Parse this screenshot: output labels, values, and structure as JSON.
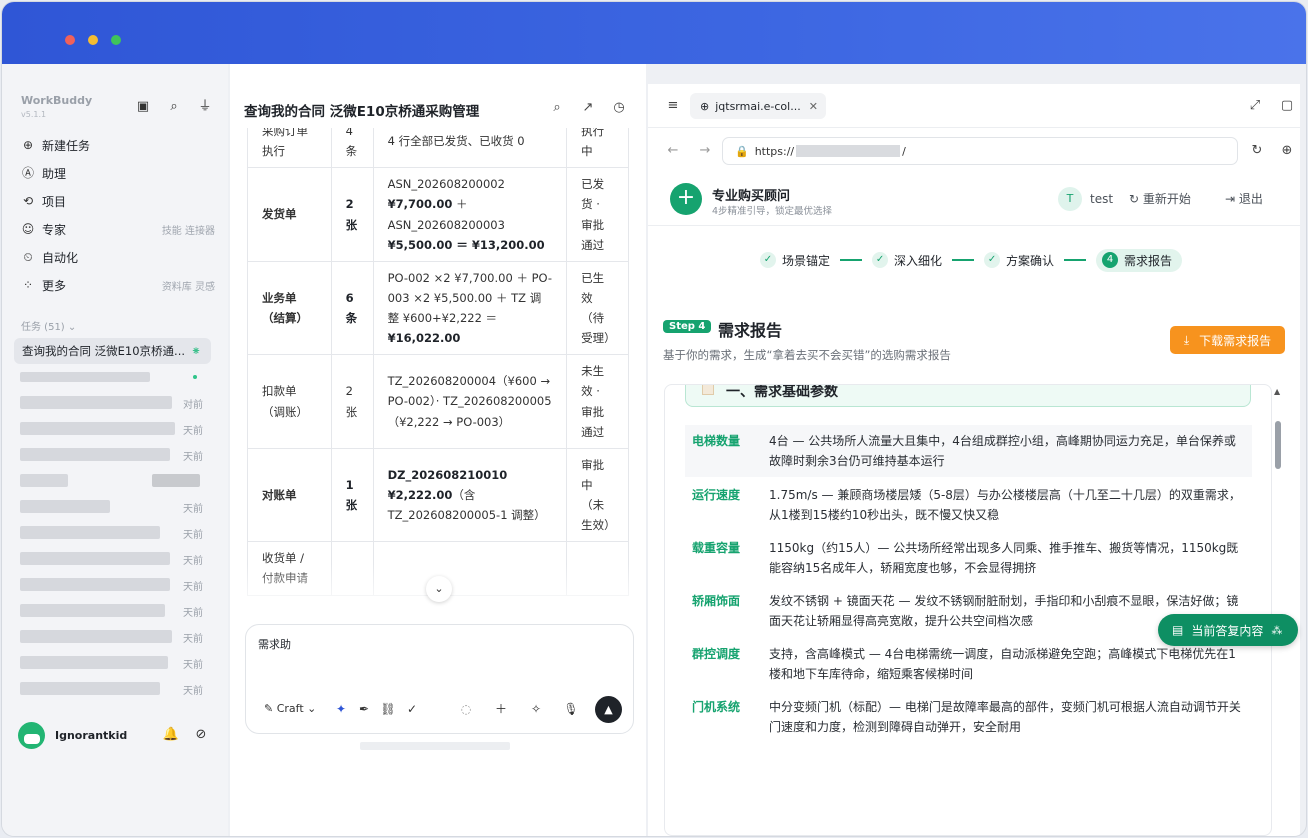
{
  "sidebar": {
    "brand": "WorkBuddy",
    "version": "v5.1.1",
    "nav": [
      {
        "icon": "plus-circle-icon",
        "label": "新建任务",
        "hint": ""
      },
      {
        "icon": "assistant-icon",
        "label": "助理",
        "hint": ""
      },
      {
        "icon": "project-icon",
        "label": "项目",
        "hint": ""
      },
      {
        "icon": "expert-icon",
        "label": "专家",
        "hint": "技能 连接器"
      },
      {
        "icon": "automation-icon",
        "label": "自动化",
        "hint": ""
      },
      {
        "icon": "more-icon",
        "label": "更多",
        "hint": "资料库 灵感"
      }
    ],
    "tasks_header": "任务 (51) ⌄",
    "active_task": "查询我的合同 泛微E10京桥通...",
    "task_times": [
      "",
      "对前",
      "天前",
      "天前",
      "",
      "天前",
      "天前",
      "天前",
      "天前",
      "天前",
      "天前",
      "天前",
      "天前"
    ],
    "username": "Ignorantkid"
  },
  "chat": {
    "title": "查询我的合同 泛微E10京桥通采购管理",
    "table": [
      {
        "c1": "采购订单执行",
        "c2": "4条",
        "c3": [
          {
            "t": "4 行全部已发货、已收货 0",
            "b": false
          }
        ],
        "c4": "执行中",
        "bold": false
      },
      {
        "c1": "发货单",
        "c2": "2张",
        "c3": [
          {
            "t": "ASN_202608200002 ",
            "b": false
          },
          {
            "t": "¥7,700.00",
            "b": true
          },
          {
            "t": " ＋ ASN_202608200003 ",
            "b": false
          },
          {
            "t": "¥5,500.00 ＝ ¥13,200.00",
            "b": true
          }
        ],
        "c4": "已发货 · 审批通过",
        "bold": true
      },
      {
        "c1": "业务单（结算）",
        "c2": "6条",
        "c3": [
          {
            "t": "PO-002 ×2 ¥7,700.00 ＋ PO-003 ×2 ¥5,500.00 ＋ TZ 调整 ¥600+¥2,222 ＝ ",
            "b": false
          },
          {
            "t": "¥16,022.00",
            "b": true
          }
        ],
        "c4": "已生效（待受理）",
        "bold": true
      },
      {
        "c1": "扣款单（调账）",
        "c2": "2张",
        "c3": [
          {
            "t": "TZ_202608200004（¥600 → PO-002）· TZ_202608200005（¥2,222 → PO-003）",
            "b": false
          }
        ],
        "c4": "未生效 · 审批通过",
        "bold": false
      },
      {
        "c1": "对账单",
        "c2": "1张",
        "c3": [
          {
            "t": "DZ_202608210010 ¥2,222.00",
            "b": true
          },
          {
            "t": "（含 TZ_202608200005-1 调整）",
            "b": false
          }
        ],
        "c4": "审批中（未生效）",
        "bold": true
      },
      {
        "c1": "收货单 / 付款申请",
        "c2": "",
        "c3": [
          {
            "t": "",
            "b": false
          }
        ],
        "c4": "",
        "bold": false
      }
    ],
    "composer_text": "需求助",
    "mode_label": "Craft"
  },
  "browser": {
    "tab_title": "jqtsrmai.e-col...",
    "url_prefix": "https://",
    "url_suffix": "/",
    "app_title": "专业购买顾问",
    "app_subtitle": "4步精准引导，锁定最优选择",
    "user_initial": "T",
    "user_name": "test",
    "restart_label": "重新开始",
    "logout_label": "退出",
    "steps": [
      "场景锚定",
      "深入细化",
      "方案确认",
      "需求报告"
    ],
    "current_step_number": "4",
    "step_badge": "Step 4",
    "report_title": "需求报告",
    "report_subtitle": "基于你的需求，生成“拿着去买不会买错”的选购需求报告",
    "download_label": "下载需求报告",
    "section_title": "一、需求基础参数",
    "params": [
      {
        "k": "电梯数量",
        "v": "4台 — 公共场所人流量大且集中，4台组成群控小组，高峰期协同运力充足，单台保养或故障时剩余3台仍可维持基本运行"
      },
      {
        "k": "运行速度",
        "v": "1.75m/s — 兼顾商场楼层矮（5-8层）与办公楼楼层高（十几至二十几层）的双重需求，从1楼到15楼约10秒出头，既不慢又快又稳"
      },
      {
        "k": "载重容量",
        "v": "1150kg（约15人）— 公共场所经常出现多人同乘、推手推车、搬货等情况，1150kg既能容纳15名成年人，轿厢宽度也够，不会显得拥挤"
      },
      {
        "k": "轿厢饰面",
        "v": "发纹不锈钢 + 镜面天花 — 发纹不锈钢耐脏耐划，手指印和小刮痕不显眼，保洁好做；镜面天花让轿厢显得高亮宽敞，提升公共空间档次感"
      },
      {
        "k": "群控调度",
        "v": "支持，含高峰模式 — 4台电梯需统一调度，自动派梯避免空跑；高峰模式下电梯优先在1楼和地下车库待命，缩短乘客候梯时间"
      },
      {
        "k": "门机系统",
        "v": "中分变频门机（标配）— 电梯门是故障率最高的部件，变频门机可根据人流自动调节开关门速度和力度，检测到障碍自动弹开，安全耐用"
      }
    ],
    "float_label": "当前答复内容"
  }
}
